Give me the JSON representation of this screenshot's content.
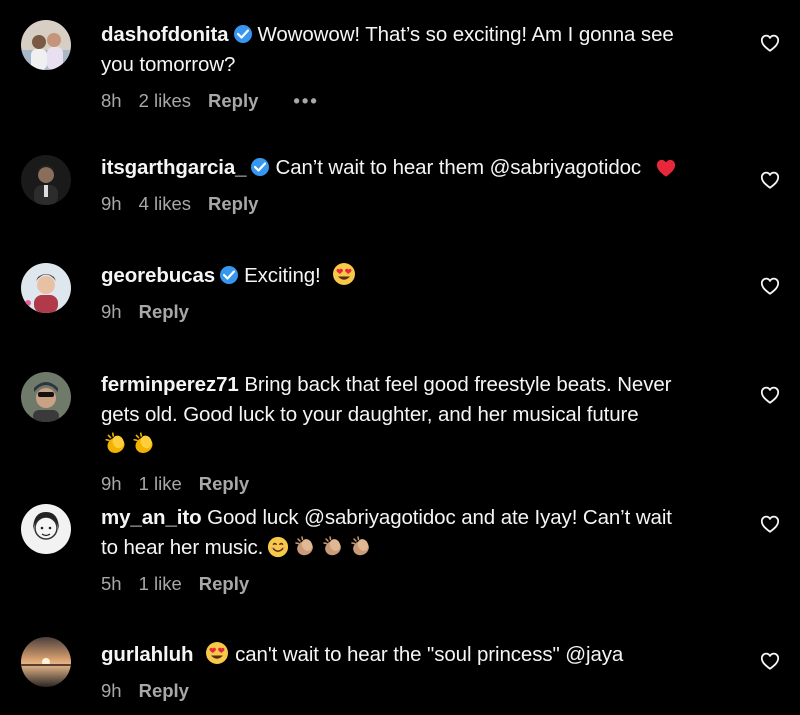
{
  "comments": [
    {
      "username": "dashofdonita",
      "verified": true,
      "text_line1": "Wowowow! That’s so exciting! Am I gonna see",
      "text_line2": "you tomorrow?",
      "time": "8h",
      "likes": "2 likes",
      "reply": "Reply",
      "more": "•••"
    },
    {
      "username": "itsgarthgarcia_",
      "verified": true,
      "text": "Can’t wait to hear them @sabriyagotidoc",
      "emoji": "red-heart",
      "time": "9h",
      "likes": "4 likes",
      "reply": "Reply"
    },
    {
      "username": "georebucas",
      "verified": true,
      "text": "Exciting!",
      "emoji": "heart-eyes",
      "time": "9h",
      "reply": "Reply"
    },
    {
      "username": "ferminperez71",
      "verified": false,
      "text_line1": "Bring back that feel good freestyle beats. Never",
      "text_line2": "gets old. Good luck to your daughter, and her musical future",
      "emoji": "clapping-hands x2",
      "time": "9h",
      "likes": "1 like",
      "reply": "Reply"
    },
    {
      "username": "my_an_ito",
      "verified": false,
      "text_line1": "Good luck @sabriyagotidoc and ate Iyay! Can’t wait",
      "text_line2": "to hear her music.",
      "emoji": "smiling-face, clapping-hands x3",
      "time": "5h",
      "likes": "1 like",
      "reply": "Reply"
    },
    {
      "username": "gurlahluh",
      "verified": false,
      "text": "can't wait to hear the \"soul princess\" @jaya",
      "emoji": "heart-eyes",
      "time": "9h",
      "reply": "Reply"
    }
  ],
  "colors": {
    "background": "#000000",
    "text": "#f5f5f5",
    "meta": "#a8a8a8",
    "verified": "#3797f0"
  },
  "icons": [
    "heart-outline-icon",
    "verified-badge-icon",
    "more-options-icon"
  ]
}
